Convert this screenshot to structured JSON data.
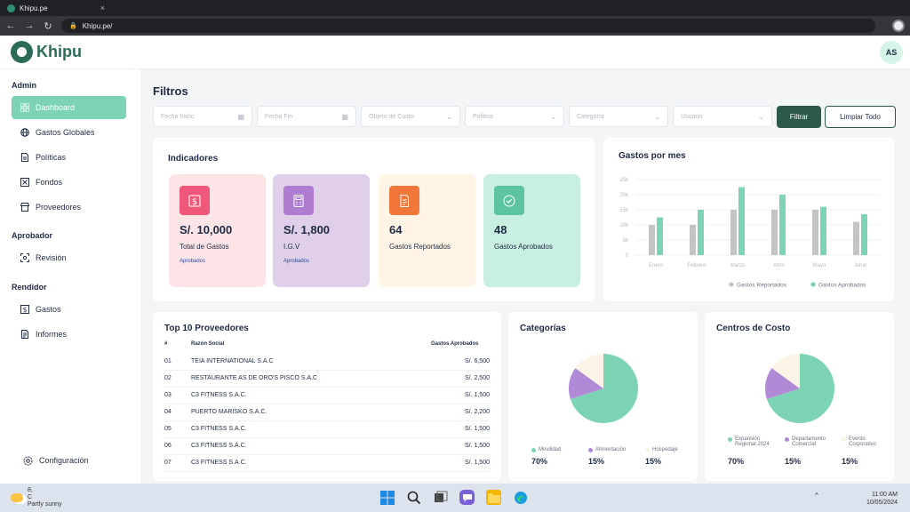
{
  "browser": {
    "tab_title": "Khipu.pe",
    "tab_close": "×",
    "url": "Khipu.pe/"
  },
  "app": {
    "logo_text": "Khipu",
    "avatar_initials": "AS"
  },
  "sidebar": {
    "sections": [
      {
        "title": "Admin",
        "items": [
          {
            "label": "Dashboard",
            "icon": "dashboard-icon",
            "active": true
          },
          {
            "label": "Gastos Globales",
            "icon": "globe-icon"
          },
          {
            "label": "Políticas",
            "icon": "document-icon"
          },
          {
            "label": "Fondos",
            "icon": "fund-icon"
          },
          {
            "label": "Proveedores",
            "icon": "store-icon"
          }
        ]
      },
      {
        "title": "Aprobador",
        "items": [
          {
            "label": "Revisión",
            "icon": "scan-icon"
          }
        ]
      },
      {
        "title": "Rendidor",
        "items": [
          {
            "label": "Gastos",
            "icon": "expense-icon"
          },
          {
            "label": "Informes",
            "icon": "report-icon"
          }
        ]
      }
    ],
    "settings_label": "Configuración"
  },
  "filters": {
    "title": "Filtros",
    "fields": [
      {
        "placeholder": "Fecha Inicio",
        "icon": "calendar-icon"
      },
      {
        "placeholder": "Fecha Fin",
        "icon": "calendar-icon"
      },
      {
        "placeholder": "Objeto de Costo",
        "icon": "chevron-down-icon"
      },
      {
        "placeholder": "Política",
        "icon": "chevron-down-icon"
      },
      {
        "placeholder": "Categoría",
        "icon": "chevron-down-icon"
      },
      {
        "placeholder": "Usuario",
        "icon": "chevron-down-icon"
      }
    ],
    "filter_button": "Filtrar",
    "clear_button": "Limpiar Todo"
  },
  "indicadores": {
    "title": "Indicadores",
    "cards": [
      {
        "value": "S/. 10,000",
        "label": "Total de Gastos",
        "sub": "Aprobados",
        "bg": "#fde4e6",
        "icon_bg": "#f0587a",
        "icon": "dollar-icon"
      },
      {
        "value": "S/. 1,800",
        "label": "I.G.V",
        "sub": "Aprobados",
        "bg": "#dfcfe9",
        "icon_bg": "#b07cd1",
        "icon": "calculator-icon"
      },
      {
        "value": "64",
        "label": "Gastos Reportados",
        "sub": "",
        "bg": "#fff4e6",
        "icon_bg": "#f2773b",
        "icon": "file-icon"
      },
      {
        "value": "48",
        "label": "Gastos Aprobados",
        "sub": "",
        "bg": "#c8efe0",
        "icon_bg": "#5cc59f",
        "icon": "check-circle-icon"
      }
    ]
  },
  "gastos_mes": {
    "title": "Gastos por mes",
    "chart_data": {
      "type": "bar",
      "categories": [
        "Enero",
        "Febrero",
        "Marzo",
        "Abril",
        "Mayo",
        "Junio"
      ],
      "series": [
        {
          "name": "Gastos Reportados",
          "values": [
            10,
            10,
            15,
            15,
            15,
            11
          ],
          "color": "#c4c4c4"
        },
        {
          "name": "Gastos Aprobados",
          "values": [
            12.5,
            15,
            22.5,
            20,
            16,
            13.5
          ],
          "color": "#7dd4b4"
        }
      ],
      "ytick_labels": [
        "25k",
        "20k",
        "15k",
        "10k",
        "5k",
        "0"
      ],
      "ylim": [
        0,
        25
      ],
      "grid": true,
      "legend": "bottom"
    }
  },
  "proveedores": {
    "title": "Top 10 Proveedores",
    "headers": [
      "#",
      "Razón Social",
      "Gastos Aprobados"
    ],
    "rows": [
      [
        "01",
        "TEIA INTERNATIONAL S.A.C",
        "S/. 6,500"
      ],
      [
        "02",
        "RESTAURANTE AS DE ORO'S PISCO S.A.C",
        "S/. 2,500"
      ],
      [
        "03",
        "C3 FITNESS S.A.C.",
        "S/. 1,500"
      ],
      [
        "04",
        "PUERTO MARISKO S.A.C.",
        "S/. 2,200"
      ],
      [
        "05",
        "C3 FITNESS S.A.C.",
        "S/. 1,500"
      ],
      [
        "06",
        "C3 FITNESS S.A.C.",
        "S/. 1,500"
      ],
      [
        "07",
        "C3 FITNESS S.A.C.",
        "S/. 1,500"
      ]
    ]
  },
  "categorias": {
    "title": "Categorías",
    "legend": [
      {
        "label": "Movilidad",
        "pct": "70%",
        "color": "#7dd4b4"
      },
      {
        "label": "Alimentación",
        "pct": "15%",
        "color": "#b08ad6"
      },
      {
        "label": "Hospedaje",
        "pct": "15%",
        "color": "#fbf4e6"
      }
    ],
    "chart_data": {
      "type": "pie",
      "labels": [
        "Movilidad",
        "Alimentación",
        "Hospedaje"
      ],
      "values": [
        70,
        15,
        15
      ]
    }
  },
  "centros": {
    "title": "Centros de Costo",
    "legend": [
      {
        "label": "Expansión Regional 2024",
        "pct": "70%",
        "color": "#7dd4b4"
      },
      {
        "label": "Departamento Comercial",
        "pct": "15%",
        "color": "#b08ad6"
      },
      {
        "label": "Evento Corporativo",
        "pct": "15%",
        "color": "#fbf4e6"
      }
    ],
    "chart_data": {
      "type": "pie",
      "labels": [
        "Expansión Regional 2024",
        "Departamento Comercial",
        "Evento Corporativo"
      ],
      "values": [
        70,
        15,
        15
      ]
    }
  },
  "taskbar": {
    "weather_temp": "8,",
    "weather_unit": "C",
    "weather_desc": "Partly sunny",
    "time": "11:00 AM",
    "date": "10/05/2024",
    "chevron": "^"
  }
}
